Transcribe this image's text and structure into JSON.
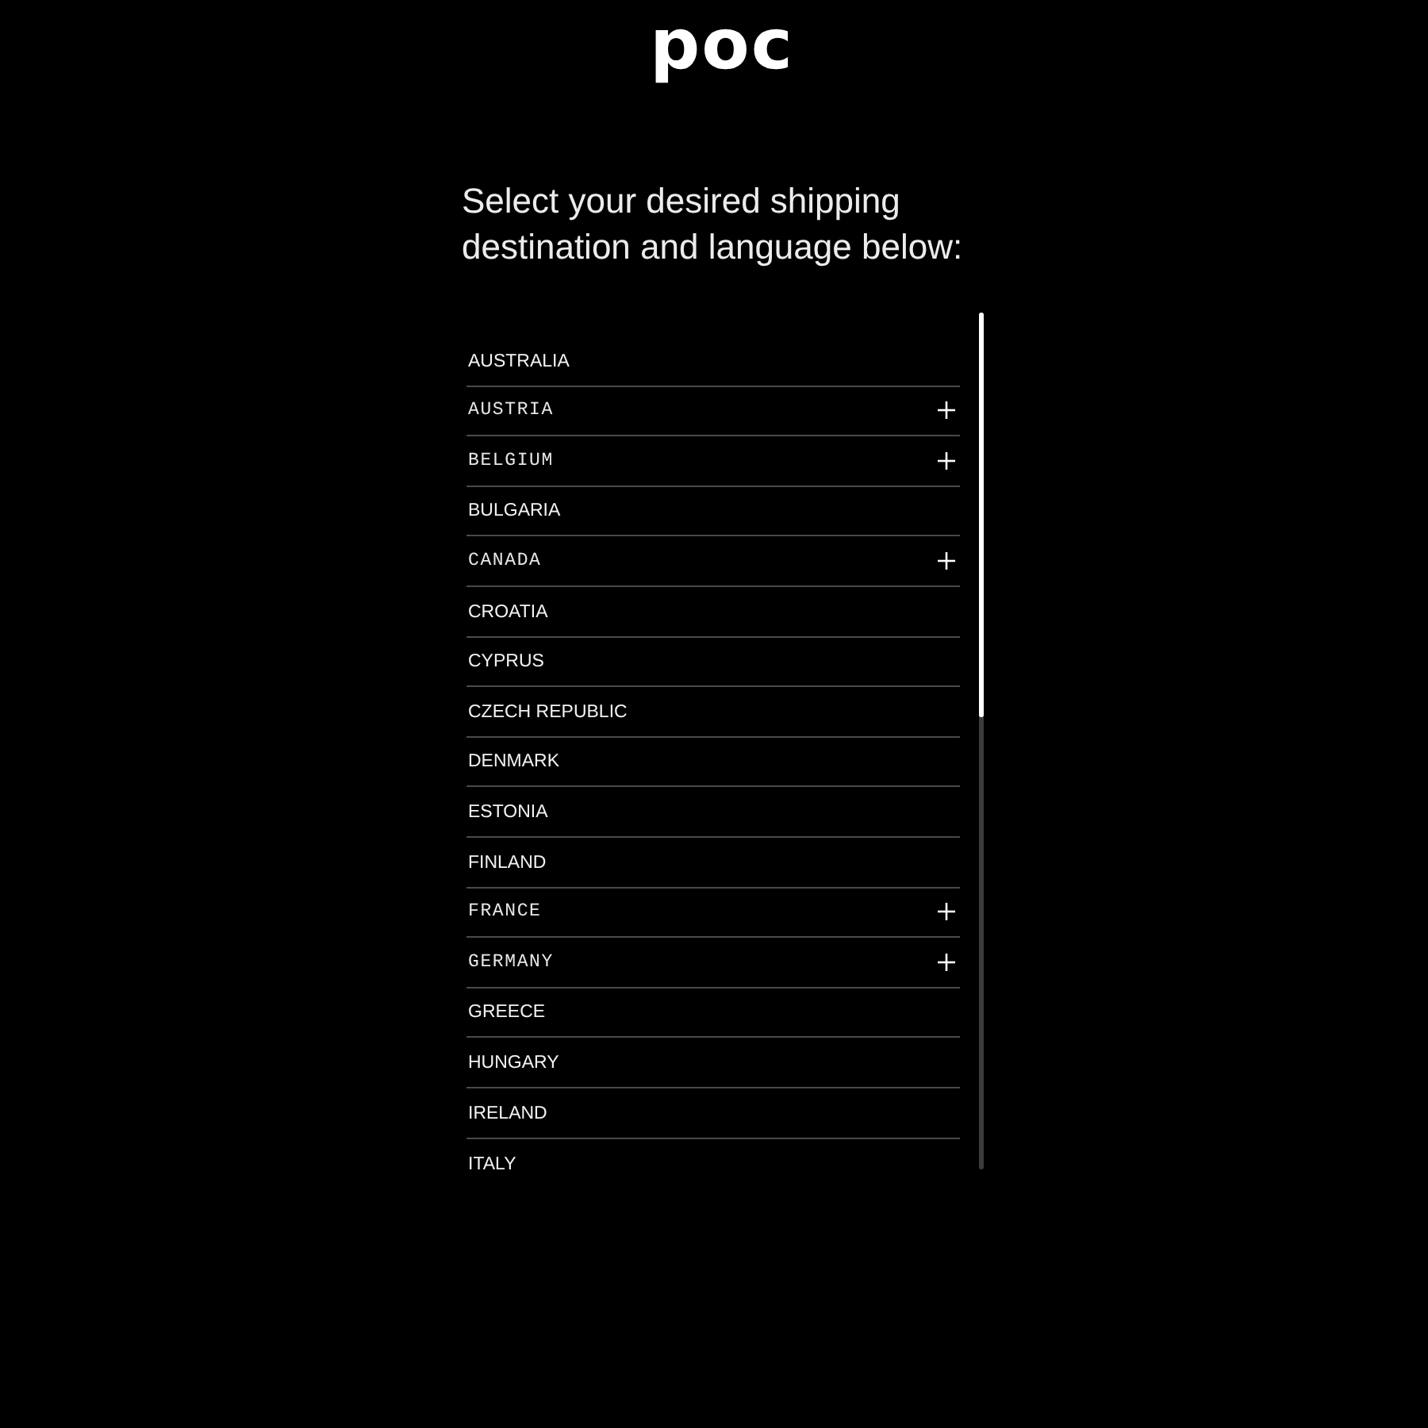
{
  "logo": "poc",
  "heading": "Select your desired shipping destination and language below:",
  "countries": [
    {
      "label": "AUSTRALIA",
      "kind": "link"
    },
    {
      "label": "AUSTRIA",
      "kind": "group",
      "expanded": false
    },
    {
      "label": "BELGIUM",
      "kind": "group",
      "expanded": false
    },
    {
      "label": "BULGARIA",
      "kind": "link"
    },
    {
      "label": "CANADA",
      "kind": "group",
      "expanded": false
    },
    {
      "label": "CROATIA",
      "kind": "link"
    },
    {
      "label": "CYPRUS",
      "kind": "link"
    },
    {
      "label": "CZECH REPUBLIC",
      "kind": "link"
    },
    {
      "label": "DENMARK",
      "kind": "link"
    },
    {
      "label": "ESTONIA",
      "kind": "link"
    },
    {
      "label": "FINLAND",
      "kind": "link"
    },
    {
      "label": "FRANCE",
      "kind": "group",
      "expanded": false
    },
    {
      "label": "GERMANY",
      "kind": "group",
      "expanded": false
    },
    {
      "label": "GREECE",
      "kind": "link"
    },
    {
      "label": "HUNGARY",
      "kind": "link"
    },
    {
      "label": "IRELAND",
      "kind": "link"
    },
    {
      "label": "ITALY",
      "kind": "link"
    }
  ]
}
